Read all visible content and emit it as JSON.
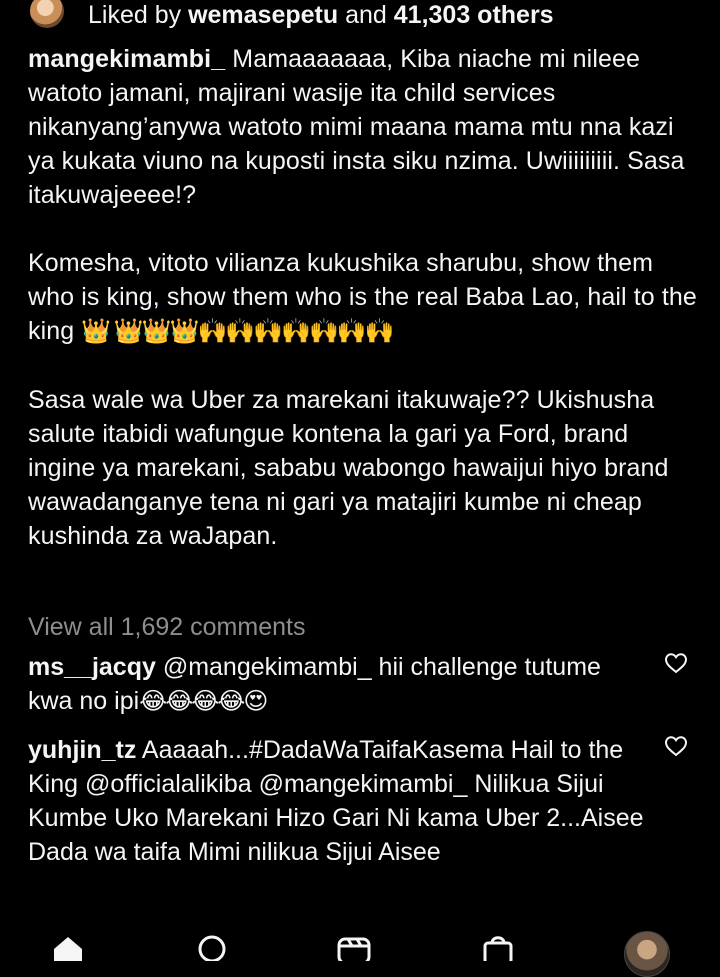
{
  "likes": {
    "prefix": "Liked by ",
    "user": "wemasepetu",
    "middle": " and ",
    "count": "41,303 others"
  },
  "post": {
    "username": "mangekimambi_",
    "p1": "Mamaaaaaaa, Kiba niache mi nileee watoto jamani, majirani wasije ita child services nikanyang’anywa watoto mimi maana mama mtu nna kazi ya kukata viuno na kuposti insta siku nzima. Uwiiiiiiiii. Sasa itakuwajeeee!?",
    "p2": "Komesha, vitoto vilianza kukushika sharubu, show them who is king, show them who is the real Baba Lao, hail to the king",
    "p2_emojis": "👑 👑👑👑🙌🙌🙌🙌🙌🙌🙌",
    "p3": "Sasa wale wa Uber za marekani itakuwaje?? Ukishusha salute itabidi wafungue kontena la gari ya Ford, brand ingine ya marekani, sababu wabongo hawaijui hiyo brand wawadanganye tena ni gari ya matajiri kumbe ni cheap kushinda za waJapan."
  },
  "view_all_comments": "View all 1,692 comments",
  "comments": [
    {
      "username": "ms__jacqy",
      "text": " @mangekimambi_ hii challenge tutume kwa no ipi",
      "emojis": "😂😂😂😂😍"
    },
    {
      "username": "yuhjin_tz",
      "text": " Aaaaah...#DadaWaTaifaKasema  Hail to the King @officialalikiba  @mangekimambi_ Nilikua Sijui Kumbe Uko Marekani Hizo Gari Ni kama Uber  2...Aisee  Dada wa taifa Mimi nilikua Sijui Aisee",
      "emojis": ""
    }
  ],
  "icons": {
    "heart": "heart-icon",
    "home": "home-icon",
    "search": "search-icon",
    "reels": "reels-icon",
    "shop": "shop-icon",
    "profile": "profile-avatar"
  },
  "colors": {
    "background": "#000000",
    "text": "#f5f5f5",
    "muted": "#8e8e8e"
  }
}
